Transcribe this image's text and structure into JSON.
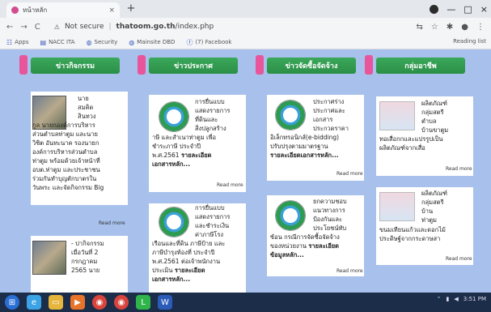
{
  "browser": {
    "tab_title": "หน้าหลัก",
    "tab_close": "×",
    "new_tab": "+",
    "back": "←",
    "forward": "→",
    "reload": "C",
    "security_label": "Not secure",
    "url_domain": "thatoom.go.th",
    "url_path": "/index.php",
    "win_minimize": "—",
    "win_maximize": "□",
    "win_close": "×",
    "bookmarks": [
      "Apps",
      "NACC ITA",
      "Security",
      "Mainsite DBD",
      "(7) Facebook"
    ],
    "reading_list": "Reading list"
  },
  "columns": [
    {
      "title": "ข่าวกิจกรรม"
    },
    {
      "title": "ข่าวประกาศ"
    },
    {
      "title": "ข่าวจัดซื้อจัดจ้าง"
    },
    {
      "title": "กลุ่มอาชีพ"
    }
  ],
  "activity": {
    "item1_lines": [
      "นาย",
      "สมคิด",
      "สินทวง",
      "กูล นายกองค์การบริหาร",
      "ส่วนตำบลท่าตูม และนาย",
      "วิชิต อันทะนาค รองนายก",
      "องค์การบริหารส่วนตำบล",
      "ท่าตูม พร้อมด้วยเจ้าหน้าที่",
      "อบต.ท่าตูม และประชาชน",
      "ร่วมกันทำบุญตักบาตรใน",
      "วันพระ และจัดกิจกรรม Big"
    ],
    "read_more": "Read more",
    "item2_lines": [
      "- ปากิจกรรม",
      "เมื่อวันที่ 2",
      "กรกฎาคม",
      "2565 นาย"
    ]
  },
  "announce": {
    "item1_lines": [
      "การยื่นแบบ",
      "แสดงรายการ",
      "ที่ดินและ",
      "สิ่งปลูกสร้าง",
      "าษี และสำเนาท่าตูม เพื่อ",
      "ชำระภาษี ประจำปี",
      "พ.ศ.2561"
    ],
    "item1_link": "รายละเอียด",
    "item1_link2": "เอกสารหลัก...",
    "read_more": "Read more",
    "item2_lines": [
      "การยื่นแบบ",
      "แสดงรายการ",
      "และชำระเงิน",
      "ค่าภาษีโรง",
      "เรือนและที่ดิน ภาษีป้าย และ",
      "ภาษีบำรุงท้องที่ ประจำปี",
      "พ.ศ.2561 ต่อเจ้าพนักงาน",
      "ประเมิน"
    ],
    "item2_link": "รายละเอียด",
    "item2_link2": "เอกสารหลัก..."
  },
  "procure": {
    "item1_lines": [
      "ประกาศร่าง",
      "ประกาศและ",
      "เอกสาร",
      "ประกวดราคา",
      "อิเล็กทรอนิกส์(e-bidding)",
      "ปรับปรุงตามมาตรฐาน"
    ],
    "item1_link": "รายละเอียดเอกสารหลัก...",
    "read_more": "Read more",
    "item2_lines": [
      "ยกความชอบ",
      "แนวทางการ",
      "ป้องกันและ",
      "ประโยชน์ทับ",
      "ซ้อน กรณีการจัดซื้อจัดจ้าง",
      "ของหน่วยงาน"
    ],
    "item2_link": "รายละเอียด",
    "item2_link2": "ข้อมูลหลัก..."
  },
  "career": {
    "item1_lines": [
      "ผลิตภัณฑ์",
      "กลุ่มสตรี",
      "ตำบล",
      "บ้านขาตูม",
      "ทอเสื่อกกและแปรรูปเป็น",
      "ผลิตภัณฑ์จากเสื่อ"
    ],
    "read_more": "Read more",
    "item2_lines": [
      "ผลิตภัณฑ์",
      "กลุ่มสตรี",
      "บ้าน",
      "ท่าตูม",
      "ขนมเทียนแก้วและดอกไม้",
      "ประดิษฐ์จากกระดาษสา"
    ]
  },
  "taskbar_apps": [
    "explorer",
    "edge",
    "files",
    "media",
    "chrome",
    "chrome-2",
    "line",
    "word"
  ],
  "clock": "3:51 PM"
}
